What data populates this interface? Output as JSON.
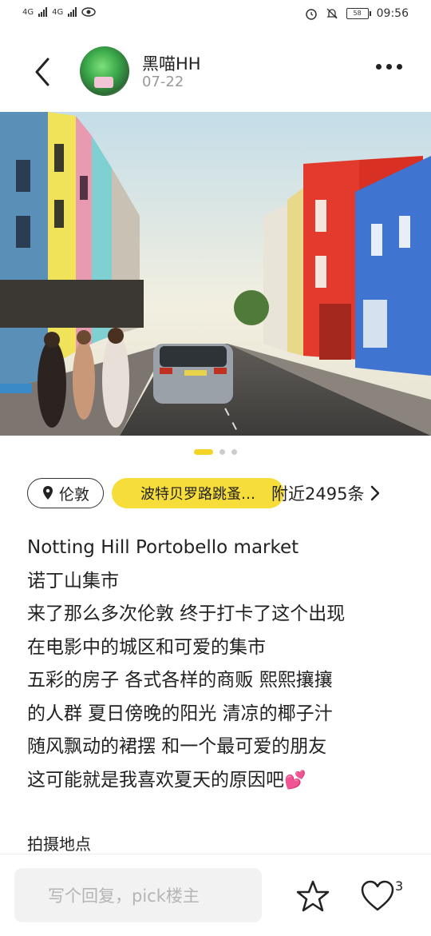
{
  "status_bar": {
    "signal1": "4G",
    "signal2": "4G",
    "battery": "58",
    "time": "09:56"
  },
  "header": {
    "username": "黑喵HH",
    "date": "07-22"
  },
  "carousel": {
    "page_count": 3,
    "current_page": 1
  },
  "tags": {
    "location": "伦敦",
    "topic": "波特贝罗路跳蚤…",
    "nearby": "附近2495条"
  },
  "post": {
    "lines": [
      "Notting Hill Portobello market",
      "诺丁山集市",
      "来了那么多次伦敦 终于打卡了这个出现",
      "在电影中的城区和可爱的集市",
      "五彩的房子 各式各样的商贩 熙熙攘攘",
      "的人群 夏日傍晚的阳光 清凉的椰子汁",
      "随风飘动的裙摆 和一个最可爱的朋友",
      "这可能就是我喜欢夏天的原因吧"
    ],
    "emoji": "💕",
    "shoot_location_label": "拍摄地点"
  },
  "bottom_bar": {
    "reply_placeholder": "写个回复，pick楼主",
    "like_count": "3"
  },
  "colors": {
    "accent_yellow": "#f7dd3a",
    "indicator_active": "#f5d325",
    "heart_emoji": "#e0306d"
  }
}
